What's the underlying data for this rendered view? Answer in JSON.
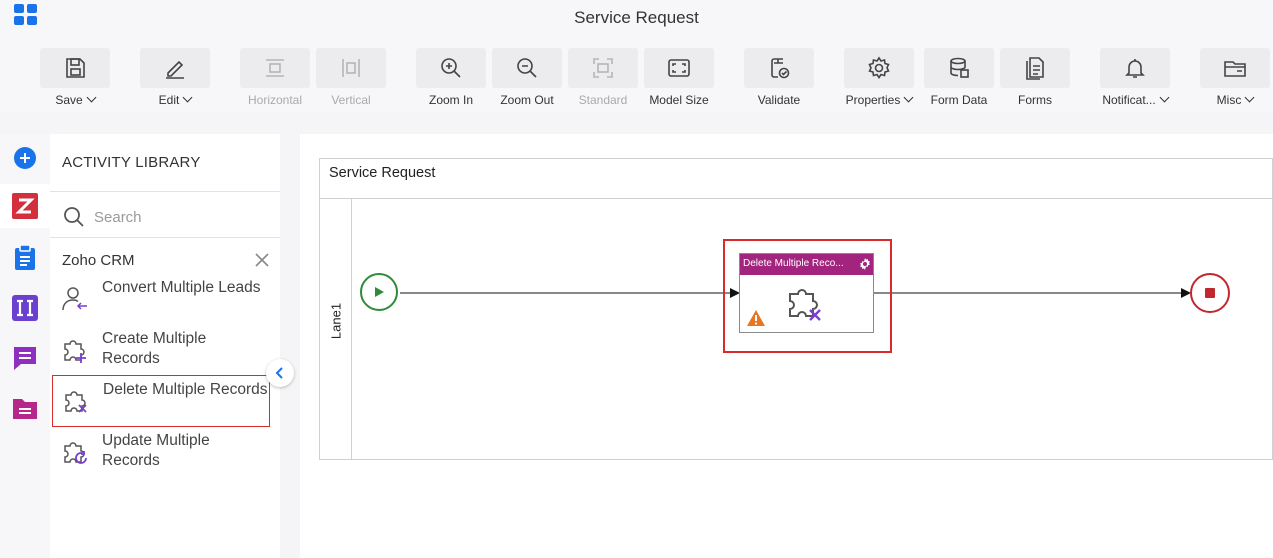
{
  "app": {
    "title": "Service Request"
  },
  "toolbar": {
    "save": "Save",
    "edit": "Edit",
    "horizontal": "Horizontal",
    "vertical": "Vertical",
    "zoom_in": "Zoom In",
    "zoom_out": "Zoom Out",
    "standard": "Standard",
    "model_size": "Model Size",
    "validate": "Validate",
    "properties": "Properties",
    "form_data": "Form Data",
    "forms": "Forms",
    "notifications": "Notificat...",
    "misc": "Misc"
  },
  "library": {
    "title": "ACTIVITY LIBRARY",
    "search_placeholder": "Search",
    "category": "Zoho CRM",
    "items": [
      {
        "label": "Convert Multiple Leads"
      },
      {
        "label": "Create Multiple Records"
      },
      {
        "label": "Delete Multiple Records"
      },
      {
        "label": "Update Multiple Records"
      }
    ]
  },
  "canvas": {
    "pool_name": "Service Request",
    "lane_name": "Lane1",
    "task": {
      "name": "Delete Multiple Reco...",
      "header_color": "#a3247e"
    }
  },
  "colors": {
    "accent": "#1a73e8",
    "selection": "#d92b2b",
    "start": "#2e8b3a",
    "end": "#c0282d"
  }
}
